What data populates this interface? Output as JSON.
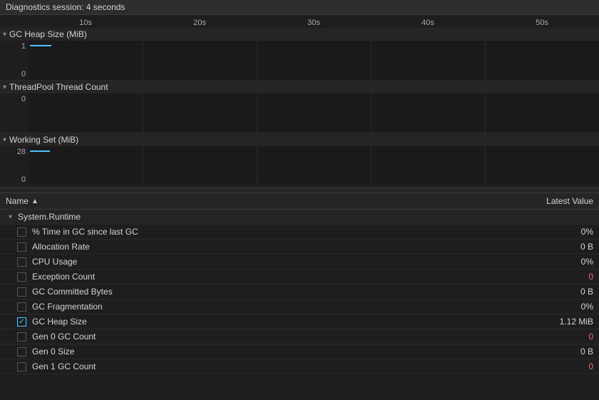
{
  "diagnostics": {
    "session_label": "Diagnostics session: 4 seconds"
  },
  "time_axis": {
    "labels": [
      "10s",
      "20s",
      "30s",
      "40s",
      "50s"
    ]
  },
  "charts": [
    {
      "id": "gc-heap",
      "title": "GC Heap Size (MiB)",
      "y_max": "1",
      "y_min": "0",
      "collapsed": false
    },
    {
      "id": "threadpool",
      "title": "ThreadPool Thread Count",
      "y_max": "0",
      "y_min": "",
      "collapsed": false
    },
    {
      "id": "working-set",
      "title": "Working Set (MiB)",
      "y_max": "28",
      "y_min": "0",
      "collapsed": false
    }
  ],
  "table": {
    "col_name": "Name",
    "col_value": "Latest Value",
    "group": "System.Runtime",
    "rows": [
      {
        "name": "% Time in GC since last GC",
        "value": "0%",
        "checked": false,
        "highlight": false
      },
      {
        "name": "Allocation Rate",
        "value": "0 B",
        "checked": false,
        "highlight": false
      },
      {
        "name": "CPU Usage",
        "value": "0%",
        "checked": false,
        "highlight": false
      },
      {
        "name": "Exception Count",
        "value": "0",
        "checked": false,
        "highlight": true
      },
      {
        "name": "GC Committed Bytes",
        "value": "0 B",
        "checked": false,
        "highlight": false
      },
      {
        "name": "GC Fragmentation",
        "value": "0%",
        "checked": false,
        "highlight": false
      },
      {
        "name": "GC Heap Size",
        "value": "1.12 MiB",
        "checked": true,
        "highlight": false
      },
      {
        "name": "Gen 0 GC Count",
        "value": "0",
        "checked": false,
        "highlight": true
      },
      {
        "name": "Gen 0 Size",
        "value": "0 B",
        "checked": false,
        "highlight": false
      },
      {
        "name": "Gen 1 GC Count",
        "value": "0",
        "checked": false,
        "highlight": true
      }
    ]
  },
  "icons": {
    "collapse": "▾",
    "expand": "▸",
    "sort_asc": "▲"
  }
}
